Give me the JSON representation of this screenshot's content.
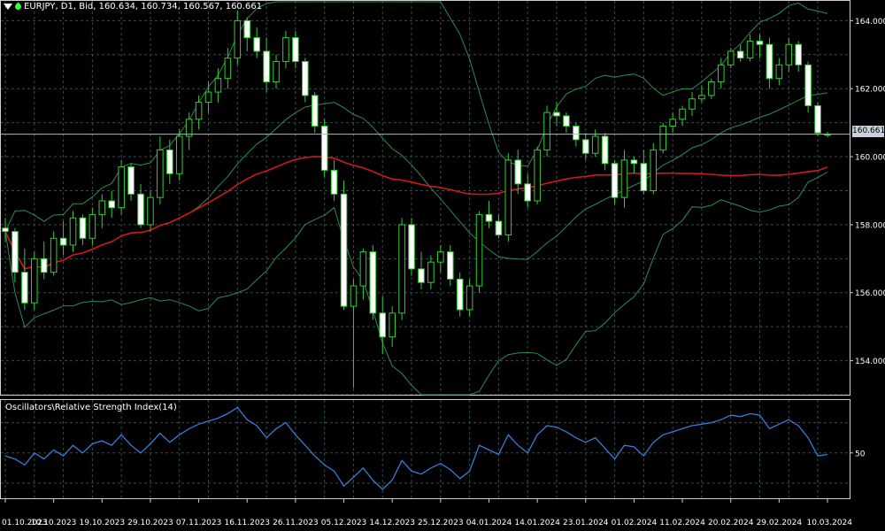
{
  "header": {
    "symbol_info": "EURJPY, D1, Bid, 160.634, 160.734, 160.567, 160.661"
  },
  "indicator": {
    "title": "Oscillators\\Relative Strength Index(14)"
  },
  "current_price_label": "160.661",
  "colors": {
    "background": "#000000",
    "grid": "#2f4f4f",
    "candle": "#32cd32",
    "bull_fill": "#000000",
    "bear_fill": "#ffffff",
    "ma": "#d01a1a",
    "bollinger": "#2e8b57",
    "rsi": "#3a7bd5",
    "price_line": "#b0b8c4"
  },
  "chart_data": [
    {
      "type": "candlestick",
      "title": "EURJPY, D1, Bid",
      "ylim": [
        153,
        164.4
      ],
      "y_ticks": [
        "164.000",
        "162.000",
        "160.000",
        "158.000",
        "156.000",
        "154.000"
      ],
      "x_ticks": [
        "01.10.2023",
        "10.10.2023",
        "19.10.2023",
        "29.10.2023",
        "07.11.2023",
        "16.11.2023",
        "26.11.2023",
        "05.12.2023",
        "14.12.2023",
        "25.12.2023",
        "04.01.2024",
        "14.01.2024",
        "23.01.2024",
        "01.02.2024",
        "11.02.2024",
        "20.02.2024",
        "29.02.2024",
        "10.03.2024"
      ],
      "last_price": 160.661,
      "candles": [
        {
          "o": 157.9,
          "h": 158.2,
          "l": 157.5,
          "c": 157.8
        },
        {
          "o": 157.8,
          "h": 157.9,
          "l": 156.3,
          "c": 156.6
        },
        {
          "o": 156.6,
          "h": 157.3,
          "l": 155.5,
          "c": 155.7
        },
        {
          "o": 155.7,
          "h": 157.2,
          "l": 155.5,
          "c": 157.0
        },
        {
          "o": 157.0,
          "h": 157.5,
          "l": 156.4,
          "c": 156.6
        },
        {
          "o": 156.6,
          "h": 157.8,
          "l": 156.5,
          "c": 157.6
        },
        {
          "o": 157.6,
          "h": 158.1,
          "l": 157.1,
          "c": 157.4
        },
        {
          "o": 157.4,
          "h": 158.4,
          "l": 157.2,
          "c": 158.2
        },
        {
          "o": 158.2,
          "h": 158.3,
          "l": 157.4,
          "c": 157.6
        },
        {
          "o": 157.6,
          "h": 158.5,
          "l": 157.4,
          "c": 158.3
        },
        {
          "o": 158.3,
          "h": 158.9,
          "l": 157.9,
          "c": 158.7
        },
        {
          "o": 158.7,
          "h": 159.0,
          "l": 158.2,
          "c": 158.5
        },
        {
          "o": 158.5,
          "h": 159.9,
          "l": 158.3,
          "c": 159.7
        },
        {
          "o": 159.7,
          "h": 159.8,
          "l": 158.7,
          "c": 158.9
        },
        {
          "o": 158.9,
          "h": 159.2,
          "l": 157.9,
          "c": 158.0
        },
        {
          "o": 158.0,
          "h": 159.0,
          "l": 157.8,
          "c": 158.8
        },
        {
          "o": 158.8,
          "h": 160.6,
          "l": 158.6,
          "c": 160.2
        },
        {
          "o": 160.2,
          "h": 160.5,
          "l": 159.2,
          "c": 159.5
        },
        {
          "o": 159.5,
          "h": 160.8,
          "l": 159.3,
          "c": 160.6
        },
        {
          "o": 160.6,
          "h": 161.3,
          "l": 160.2,
          "c": 161.1
        },
        {
          "o": 161.1,
          "h": 161.8,
          "l": 160.8,
          "c": 161.6
        },
        {
          "o": 161.6,
          "h": 162.2,
          "l": 161.3,
          "c": 161.9
        },
        {
          "o": 161.9,
          "h": 162.6,
          "l": 161.6,
          "c": 162.3
        },
        {
          "o": 162.3,
          "h": 163.2,
          "l": 162.0,
          "c": 162.9
        },
        {
          "o": 162.9,
          "h": 164.3,
          "l": 162.7,
          "c": 164.0
        },
        {
          "o": 164.0,
          "h": 164.1,
          "l": 163.1,
          "c": 163.5
        },
        {
          "o": 163.5,
          "h": 163.8,
          "l": 162.9,
          "c": 163.1
        },
        {
          "o": 163.1,
          "h": 163.5,
          "l": 161.9,
          "c": 162.2
        },
        {
          "o": 162.2,
          "h": 163.0,
          "l": 162.0,
          "c": 162.8
        },
        {
          "o": 162.8,
          "h": 163.7,
          "l": 162.6,
          "c": 163.5
        },
        {
          "o": 163.5,
          "h": 163.7,
          "l": 162.6,
          "c": 162.8
        },
        {
          "o": 162.8,
          "h": 162.9,
          "l": 161.6,
          "c": 161.8
        },
        {
          "o": 161.8,
          "h": 161.9,
          "l": 160.7,
          "c": 160.9
        },
        {
          "o": 160.9,
          "h": 161.1,
          "l": 159.4,
          "c": 159.6
        },
        {
          "o": 159.6,
          "h": 159.9,
          "l": 158.7,
          "c": 158.9
        },
        {
          "o": 158.9,
          "h": 159.3,
          "l": 155.5,
          "c": 155.6
        },
        {
          "o": 155.6,
          "h": 156.4,
          "l": 153.2,
          "c": 156.2
        },
        {
          "o": 156.2,
          "h": 157.3,
          "l": 155.8,
          "c": 157.2
        },
        {
          "o": 157.2,
          "h": 157.4,
          "l": 155.2,
          "c": 155.4
        },
        {
          "o": 155.4,
          "h": 155.9,
          "l": 154.2,
          "c": 154.7
        },
        {
          "o": 154.7,
          "h": 155.6,
          "l": 154.4,
          "c": 155.4
        },
        {
          "o": 155.4,
          "h": 158.2,
          "l": 155.2,
          "c": 158.0
        },
        {
          "o": 158.0,
          "h": 158.2,
          "l": 156.5,
          "c": 156.7
        },
        {
          "o": 156.7,
          "h": 157.2,
          "l": 156.1,
          "c": 156.3
        },
        {
          "o": 156.3,
          "h": 157.1,
          "l": 156.1,
          "c": 156.9
        },
        {
          "o": 156.9,
          "h": 157.4,
          "l": 156.6,
          "c": 157.2
        },
        {
          "o": 157.2,
          "h": 157.4,
          "l": 156.2,
          "c": 156.4
        },
        {
          "o": 156.4,
          "h": 156.6,
          "l": 155.3,
          "c": 155.5
        },
        {
          "o": 155.5,
          "h": 156.4,
          "l": 155.3,
          "c": 156.2
        },
        {
          "o": 156.2,
          "h": 158.4,
          "l": 156.0,
          "c": 158.3
        },
        {
          "o": 158.3,
          "h": 158.7,
          "l": 157.9,
          "c": 158.1
        },
        {
          "o": 158.1,
          "h": 158.3,
          "l": 157.6,
          "c": 157.7
        },
        {
          "o": 157.7,
          "h": 160.1,
          "l": 157.5,
          "c": 159.9
        },
        {
          "o": 159.9,
          "h": 160.2,
          "l": 158.9,
          "c": 159.2
        },
        {
          "o": 159.2,
          "h": 159.5,
          "l": 158.5,
          "c": 158.7
        },
        {
          "o": 158.7,
          "h": 160.3,
          "l": 158.6,
          "c": 160.2
        },
        {
          "o": 160.2,
          "h": 161.5,
          "l": 160.0,
          "c": 161.3
        },
        {
          "o": 161.3,
          "h": 161.6,
          "l": 160.9,
          "c": 161.2
        },
        {
          "o": 161.2,
          "h": 161.3,
          "l": 160.7,
          "c": 160.9
        },
        {
          "o": 160.9,
          "h": 161.0,
          "l": 160.3,
          "c": 160.5
        },
        {
          "o": 160.5,
          "h": 160.7,
          "l": 159.9,
          "c": 160.1
        },
        {
          "o": 160.1,
          "h": 160.8,
          "l": 160.0,
          "c": 160.6
        },
        {
          "o": 160.6,
          "h": 160.7,
          "l": 159.6,
          "c": 159.8
        },
        {
          "o": 159.8,
          "h": 159.9,
          "l": 158.6,
          "c": 158.8
        },
        {
          "o": 158.8,
          "h": 160.2,
          "l": 158.5,
          "c": 159.9
        },
        {
          "o": 159.9,
          "h": 160.0,
          "l": 159.5,
          "c": 159.8
        },
        {
          "o": 159.8,
          "h": 160.2,
          "l": 158.9,
          "c": 159.0
        },
        {
          "o": 159.0,
          "h": 160.4,
          "l": 158.9,
          "c": 160.2
        },
        {
          "o": 160.2,
          "h": 161.0,
          "l": 160.1,
          "c": 160.9
        },
        {
          "o": 160.9,
          "h": 161.3,
          "l": 160.7,
          "c": 161.1
        },
        {
          "o": 161.1,
          "h": 161.5,
          "l": 160.9,
          "c": 161.4
        },
        {
          "o": 161.4,
          "h": 161.9,
          "l": 161.2,
          "c": 161.7
        },
        {
          "o": 161.7,
          "h": 162.1,
          "l": 161.6,
          "c": 161.8
        },
        {
          "o": 161.8,
          "h": 162.3,
          "l": 161.7,
          "c": 162.2
        },
        {
          "o": 162.2,
          "h": 162.9,
          "l": 162.0,
          "c": 162.7
        },
        {
          "o": 162.7,
          "h": 163.2,
          "l": 162.6,
          "c": 163.1
        },
        {
          "o": 163.1,
          "h": 163.3,
          "l": 162.8,
          "c": 162.9
        },
        {
          "o": 162.9,
          "h": 163.6,
          "l": 162.8,
          "c": 163.4
        },
        {
          "o": 163.4,
          "h": 163.6,
          "l": 162.9,
          "c": 163.3
        },
        {
          "o": 163.3,
          "h": 163.5,
          "l": 162.0,
          "c": 162.3
        },
        {
          "o": 162.3,
          "h": 162.9,
          "l": 162.1,
          "c": 162.7
        },
        {
          "o": 162.7,
          "h": 163.5,
          "l": 162.5,
          "c": 163.3
        },
        {
          "o": 163.3,
          "h": 163.4,
          "l": 162.5,
          "c": 162.7
        },
        {
          "o": 162.7,
          "h": 162.8,
          "l": 161.3,
          "c": 161.5
        },
        {
          "o": 161.5,
          "h": 161.6,
          "l": 160.6,
          "c": 160.7
        },
        {
          "o": 160.634,
          "h": 160.734,
          "l": 160.567,
          "c": 160.661
        }
      ]
    },
    {
      "type": "line",
      "title": "Oscillators\\Relative Strength Index(14)",
      "y_ticks": [
        "50"
      ],
      "ylim": [
        20,
        85
      ],
      "rsi": [
        48,
        46,
        42,
        50,
        46,
        52,
        48,
        55,
        50,
        56,
        58,
        55,
        62,
        55,
        50,
        56,
        63,
        57,
        62,
        66,
        69,
        71,
        73,
        76,
        80,
        72,
        68,
        60,
        66,
        70,
        62,
        55,
        48,
        42,
        38,
        28,
        34,
        40,
        32,
        26,
        32,
        45,
        38,
        36,
        40,
        43,
        39,
        33,
        38,
        55,
        52,
        49,
        62,
        55,
        50,
        62,
        68,
        67,
        64,
        60,
        57,
        60,
        53,
        46,
        55,
        54,
        48,
        57,
        62,
        64,
        66,
        68,
        69,
        70,
        72,
        75,
        74,
        76,
        75,
        66,
        69,
        72,
        68,
        60,
        48,
        49
      ]
    }
  ]
}
